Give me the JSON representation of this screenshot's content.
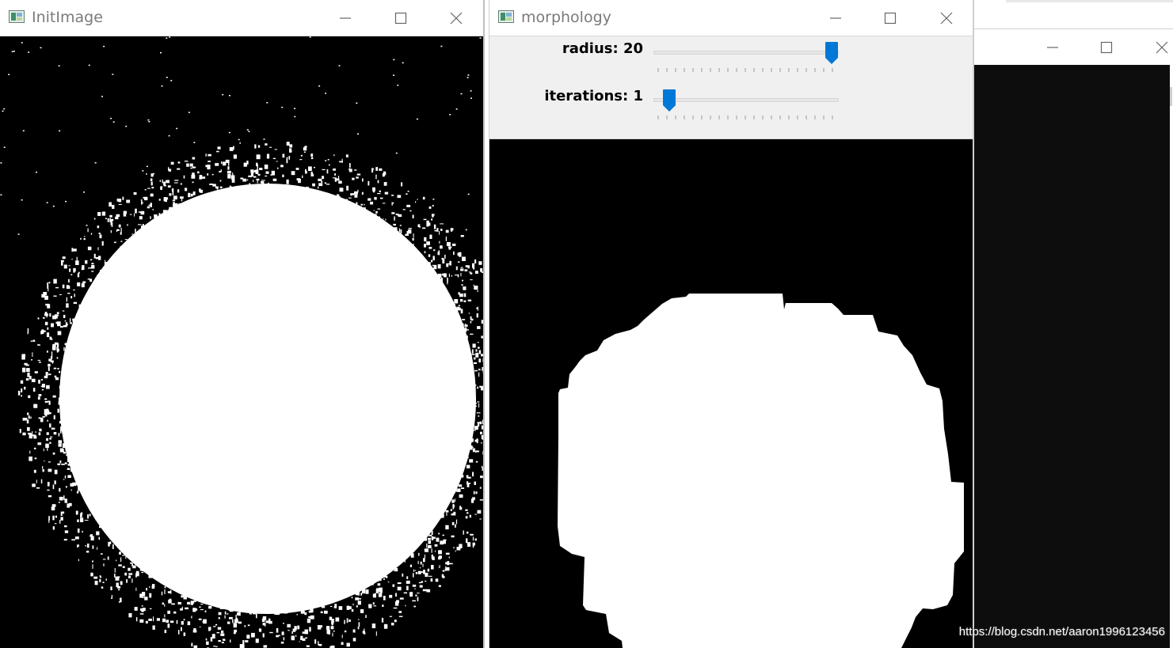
{
  "windows": {
    "init_image": {
      "title": "InitImage",
      "minimize_glyph": "—",
      "maximize_glyph": "☐",
      "close_glyph": "✕"
    },
    "morphology": {
      "title": "morphology",
      "trackbars": [
        {
          "label": "radius: 20",
          "value": 20,
          "max": 20
        },
        {
          "label": "iterations: 1",
          "value": 1,
          "max": 20
        }
      ]
    },
    "background_window": {
      "title": ""
    }
  },
  "watermark": "https://blog.csdn.net/aaron1996123456",
  "colors": {
    "accent": "#0078d7",
    "image_background": "#000000",
    "image_foreground": "#ffffff",
    "panel": "#f0f0f0"
  },
  "icons": {
    "app_icon": "opencv-window-icon",
    "minimize": "minimize-icon",
    "maximize": "maximize-icon",
    "close": "close-icon"
  }
}
